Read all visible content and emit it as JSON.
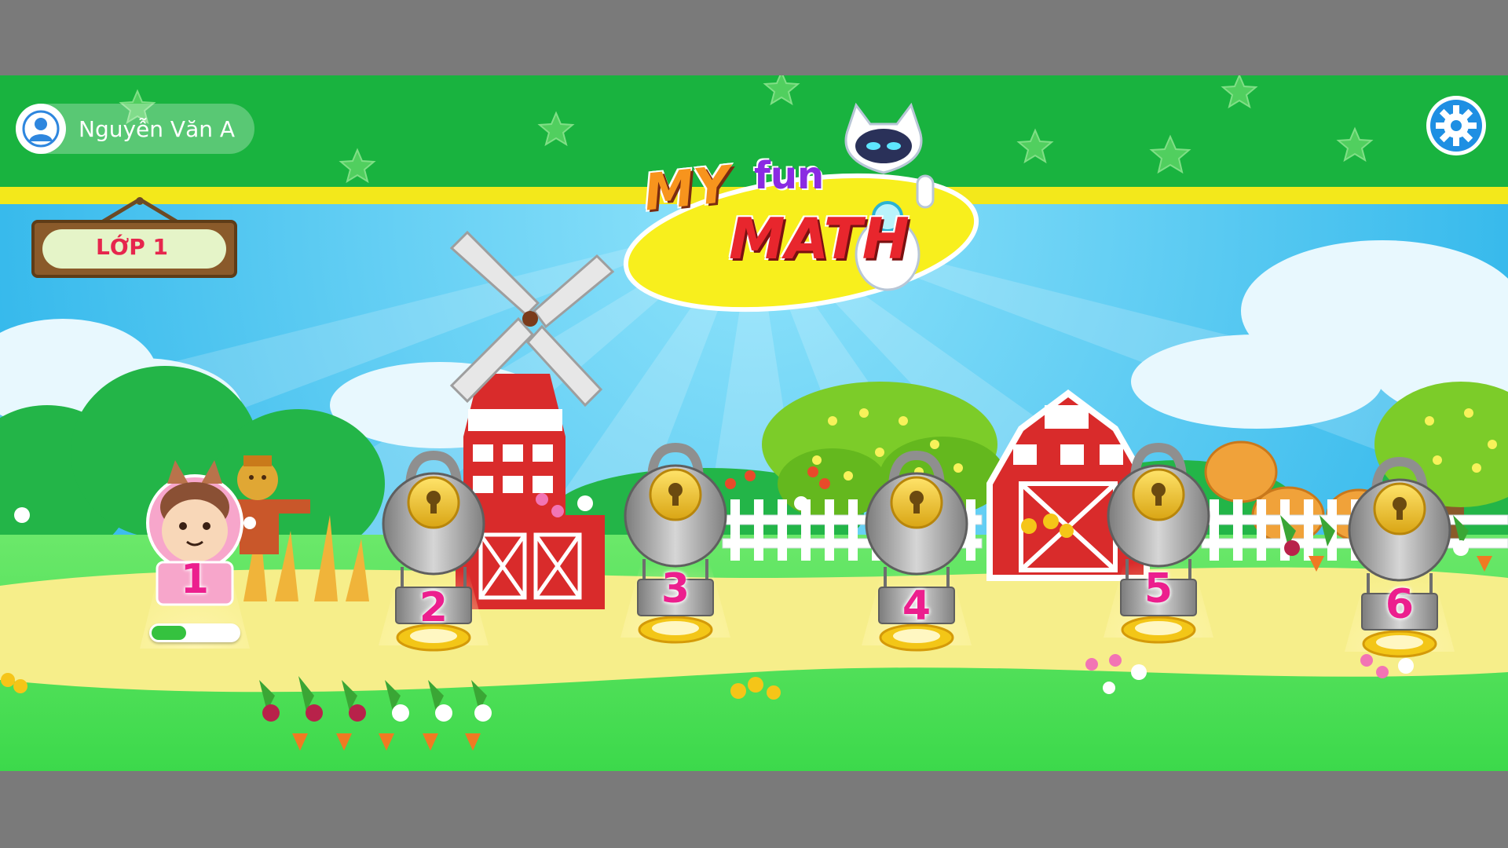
{
  "user": {
    "name": "Nguyễn Văn A",
    "avatar_icon": "user-avatar-icon"
  },
  "settings": {
    "icon": "gear-icon"
  },
  "logo": {
    "word_my": "MY",
    "word_fun": "fun",
    "word_math": "MATH"
  },
  "grade_sign": {
    "label": "LỚP 1"
  },
  "levels": [
    {
      "number": "1",
      "state": "unlocked",
      "icon": "pony-balloon-icon",
      "progress": 0.4
    },
    {
      "number": "2",
      "state": "locked",
      "icon": "lock-icon"
    },
    {
      "number": "3",
      "state": "locked",
      "icon": "lock-icon"
    },
    {
      "number": "4",
      "state": "locked",
      "icon": "lock-icon"
    },
    {
      "number": "5",
      "state": "locked",
      "icon": "lock-icon"
    },
    {
      "number": "6",
      "state": "locked",
      "icon": "lock-icon"
    }
  ],
  "colors": {
    "header_green": "#19b33f",
    "header_stripe": "#f3e81b",
    "sky": "#47c6ef",
    "grass": "#47e24f",
    "path": "#f6ee8a",
    "level_number": "#ec1f8e",
    "progress_fill": "#35c23f"
  }
}
